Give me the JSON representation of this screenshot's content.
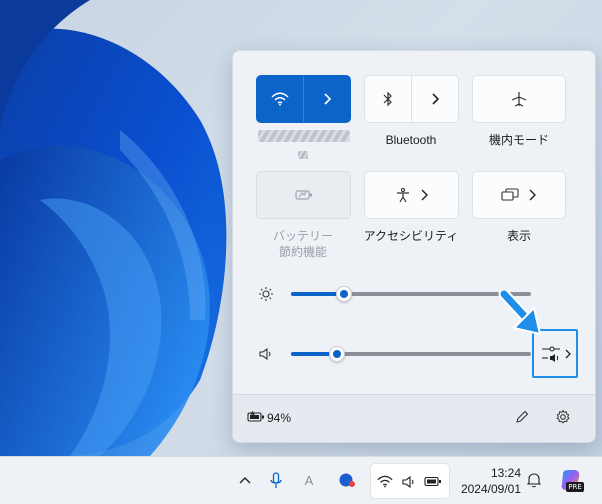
{
  "quick_settings": {
    "tiles": {
      "bluetooth_label": "Bluetooth",
      "airplane_label": "機内モード",
      "battery_saver_label_line1": "バッテリー",
      "battery_saver_label_line2": "節約機能",
      "accessibility_label": "アクセシビリティ",
      "display_label": "表示"
    },
    "wifi_on": true,
    "brightness_level": 0.22,
    "volume_level": 0.19,
    "battery_percent": "94%"
  },
  "taskbar": {
    "time": "13:24",
    "date": "2024/09/01",
    "ime_indicator": "A",
    "copilot_badge": "PRE"
  },
  "colors": {
    "accent": "#0c64c8",
    "highlight": "#1f8ee8"
  },
  "icons": [
    "wifi-icon",
    "bluetooth-icon",
    "airplane-icon",
    "battery-saver-icon",
    "accessibility-icon",
    "display-icon",
    "brightness-icon",
    "volume-icon",
    "audio-output-icon",
    "battery-icon",
    "edit-icon",
    "settings-icon",
    "chevron-up-icon",
    "microphone-icon",
    "bell-icon",
    "copilot-icon"
  ]
}
